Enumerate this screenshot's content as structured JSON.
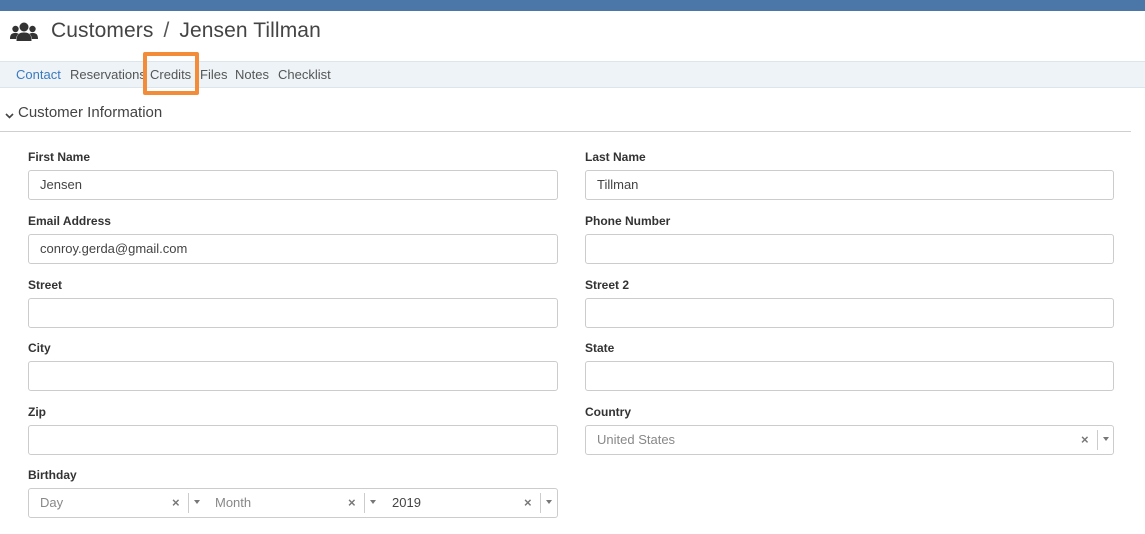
{
  "header": {
    "icon": "users-icon",
    "breadcrumb_root": "Customers",
    "separator": "/",
    "customer_name": "Jensen Tillman"
  },
  "tabs": [
    {
      "label": "Contact",
      "active": true
    },
    {
      "label": "Reservations",
      "active": false
    },
    {
      "label": "Credits",
      "active": false
    },
    {
      "label": "Files",
      "active": false
    },
    {
      "label": "Notes",
      "active": false
    },
    {
      "label": "Checklist",
      "active": false
    }
  ],
  "section": {
    "title": "Customer Information",
    "expanded": true
  },
  "form": {
    "first_name": {
      "label": "First Name",
      "value": "Jensen"
    },
    "last_name": {
      "label": "Last Name",
      "value": "Tillman"
    },
    "email": {
      "label": "Email Address",
      "value": "conroy.gerda@gmail.com"
    },
    "phone": {
      "label": "Phone Number",
      "value": ""
    },
    "street": {
      "label": "Street",
      "value": ""
    },
    "street2": {
      "label": "Street 2",
      "value": ""
    },
    "city": {
      "label": "City",
      "value": ""
    },
    "state": {
      "label": "State",
      "value": ""
    },
    "zip": {
      "label": "Zip",
      "value": ""
    },
    "country": {
      "label": "Country",
      "value": "United States"
    },
    "birthday": {
      "label": "Birthday",
      "day_placeholder": "Day",
      "month_placeholder": "Month",
      "year_value": "2019"
    }
  },
  "colors": {
    "topbar": "#4a76a8",
    "active_tab": "#3a7bbf",
    "highlight": "#f28c38"
  }
}
